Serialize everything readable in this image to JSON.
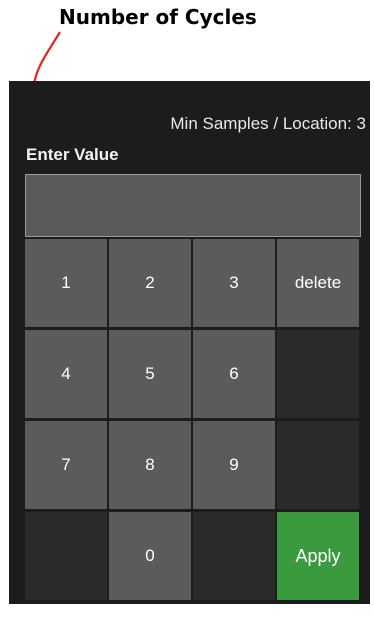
{
  "annotation": {
    "title": "Number of Cycles",
    "arrow_color": "#e8231c"
  },
  "dialog": {
    "min_samples_text": "Min Samples / Location: 3",
    "enter_value_label": "Enter Value",
    "input_value": "",
    "keys": {
      "k1": "1",
      "k2": "2",
      "k3": "3",
      "delete": "delete",
      "k4": "4",
      "k5": "5",
      "k6": "6",
      "k7": "7",
      "k8": "8",
      "k9": "9",
      "k0": "0",
      "apply": "Apply"
    },
    "colors": {
      "panel_bg": "#1c1c1c",
      "key_bg": "#5b5b5b",
      "blank_key_bg": "#2a2a2a",
      "apply_bg": "#3b9a3e"
    }
  }
}
